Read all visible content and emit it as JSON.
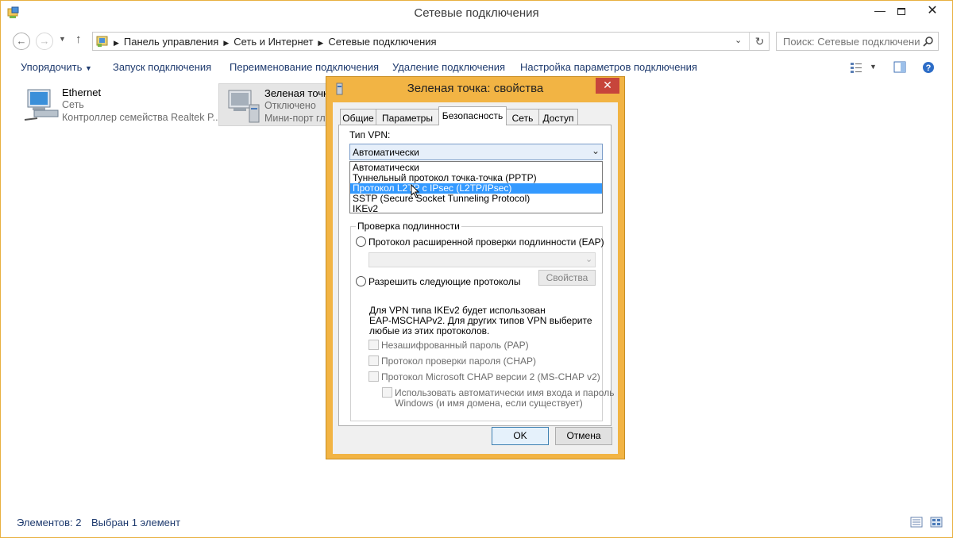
{
  "window": {
    "title": "Сетевые подключения",
    "minimize_icon": "minimize-icon",
    "maximize_icon": "maximize-icon",
    "close_icon": "close-icon"
  },
  "address": {
    "breadcrumbs": [
      "Панель управления",
      "Сеть и Интернет",
      "Сетевые подключения"
    ],
    "search_placeholder": "Поиск: Сетевые подключения"
  },
  "commands": {
    "organize": "Упорядочить",
    "connect": "Запуск подключения",
    "rename": "Переименование подключения",
    "delete": "Удаление подключения",
    "settings": "Настройка параметров подключения"
  },
  "connections": [
    {
      "name": "Ethernet",
      "status": "Сеть",
      "device": "Контроллер семейства Realtek P..."
    },
    {
      "name": "Зеленая точка",
      "status": "Отключено",
      "device": "Мини-порт гл"
    }
  ],
  "status": {
    "count": "Элементов: 2",
    "selected": "Выбран 1 элемент"
  },
  "dialog": {
    "title": "Зеленая точка: свойства",
    "tabs": [
      "Общие",
      "Параметры",
      "Безопасность",
      "Сеть",
      "Доступ"
    ],
    "active_tab": "Безопасность",
    "vpn_type_label": "Тип VPN:",
    "vpn_type_value": "Автоматически",
    "vpn_options": [
      "Автоматически",
      "Туннельный протокол точка-точка (PPTP)",
      "Протокол L2TP с IPsec (L2TP/IPsec)",
      "SSTP (Secure Socket Tunneling Protocol)",
      "IKEv2"
    ],
    "highlighted_option": "Протокол L2TP с IPsec (L2TP/IPsec)",
    "auth_group_label": "Проверка подлинности",
    "eap_label": "Протокол расширенной проверки подлинности (EAP)",
    "allow_label": "Разрешить следующие протоколы",
    "properties_button": "Свойства",
    "note_line1": "Для VPN типа IKEv2 будет использован",
    "note_line2": "EAP-MSCHAPv2. Для других типов VPN выберите",
    "note_line3": "любые из этих протоколов.",
    "pap_label": "Незашифрованный пароль (PAP)",
    "chap_label": "Протокол проверки пароля (CHAP)",
    "mschap_label": "Протокол Microsoft CHAP версии 2 (MS-CHAP v2)",
    "autologon_line1": "Использовать автоматически имя входа и пароль",
    "autologon_line2": "Windows (и имя домена, если существует)",
    "ok": "OK",
    "cancel": "Отмена"
  },
  "colors": {
    "accent_border": "#f2b444",
    "close_red": "#c7453b",
    "selection_blue": "#3399ff",
    "link_blue": "#1e3a6e"
  }
}
